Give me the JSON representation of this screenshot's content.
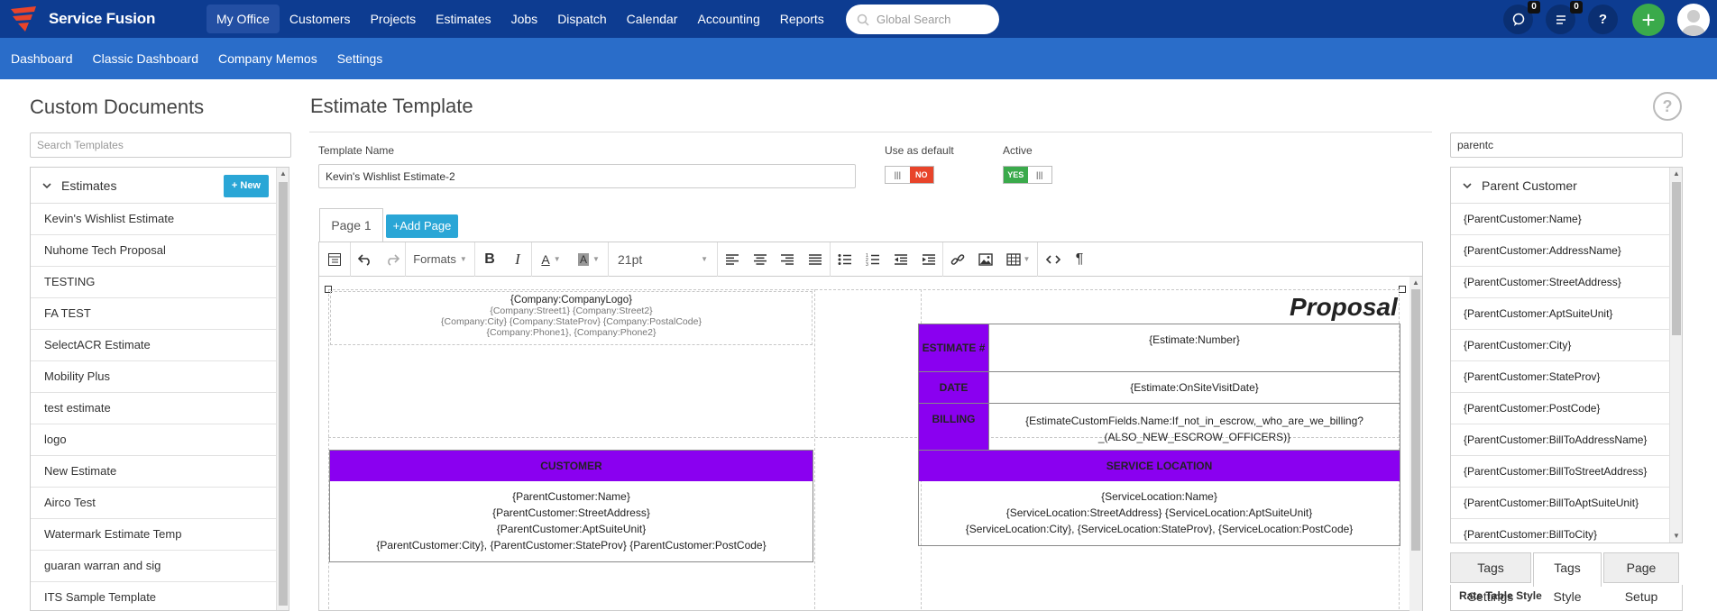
{
  "brand": {
    "name": "Service Fusion"
  },
  "topnav": {
    "items": [
      "My Office",
      "Customers",
      "Projects",
      "Estimates",
      "Jobs",
      "Dispatch",
      "Calendar",
      "Accounting",
      "Reports"
    ],
    "active": "My Office",
    "search_placeholder": "Global Search",
    "chat_count": "0",
    "tasks_count": "0",
    "help_label": "?"
  },
  "subnav": {
    "items": [
      "Dashboard",
      "Classic Dashboard",
      "Company Memos",
      "Settings"
    ]
  },
  "left": {
    "title": "Custom Documents",
    "search_placeholder": "Search Templates",
    "section": "Estimates",
    "new_label": "New",
    "items": [
      "Kevin's Wishlist Estimate",
      "Nuhome Tech Proposal",
      "TESTING",
      "FA TEST",
      "SelectACR Estimate",
      "Mobility Plus",
      "test estimate",
      "logo",
      "New Estimate",
      "Airco Test",
      "Watermark Estimate Temp",
      "guaran warran and sig",
      "ITS Sample Template"
    ]
  },
  "main": {
    "title": "Estimate Template",
    "help": "?",
    "template_name_label": "Template Name",
    "template_name_value": "Kevin's Wishlist Estimate-2",
    "default_label": "Use as default",
    "default_state": "NO",
    "active_label": "Active",
    "active_state": "YES",
    "page_tab": "Page 1",
    "add_page": "Add Page",
    "toolbar": {
      "formats": "Formats",
      "font_size": "21pt"
    }
  },
  "doc": {
    "company": {
      "logo": "{Company:CompanyLogo}",
      "street": "{Company:Street1} {Company:Street2}",
      "city": "{Company:City} {Company:StateProv} {Company:PostalCode}",
      "phone": "{Company:Phone1}, {Company:Phone2}"
    },
    "proposal": "Proposal",
    "estimate_label": "ESTIMATE #",
    "estimate_value": "{Estimate:Number}",
    "date_label": "DATE",
    "date_value": "{Estimate:OnSiteVisitDate}",
    "billing_label": "BILLING",
    "billing_value_1": "{EstimateCustomFields.Name:If_not_in_escrow,_who_are_we_billing?",
    "billing_value_2": "_(ALSO_NEW_ESCROW_OFFICERS)}",
    "customer_header": "CUSTOMER",
    "customer_lines": [
      "{ParentCustomer:Name}",
      "{ParentCustomer:StreetAddress}",
      "{ParentCustomer:AptSuiteUnit}",
      "{ParentCustomer:City}, {ParentCustomer:StateProv} {ParentCustomer:PostCode}"
    ],
    "service_header": "SERVICE LOCATION",
    "service_lines": [
      "{ServiceLocation:Name}",
      "{ServiceLocation:StreetAddress} {ServiceLocation:AptSuiteUnit}",
      "{ServiceLocation:City}, {ServiceLocation:StateProv}, {ServiceLocation:PostCode}"
    ]
  },
  "right": {
    "search_value": "parentc",
    "section": "Parent Customer",
    "tags": [
      "{ParentCustomer:Name}",
      "{ParentCustomer:AddressName}",
      "{ParentCustomer:StreetAddress}",
      "{ParentCustomer:AptSuiteUnit}",
      "{ParentCustomer:City}",
      "{ParentCustomer:StateProv}",
      "{ParentCustomer:PostCode}",
      "{ParentCustomer:BillToAddressName}",
      "{ParentCustomer:BillToStreetAddress}",
      "{ParentCustomer:BillToAptSuiteUnit}",
      "{ParentCustomer:BillToCity}"
    ],
    "tabs": [
      "Tags Settings",
      "Tags Style",
      "Page Setup"
    ],
    "active_tab": "Tags Style",
    "style_section": "Rate Table Style"
  },
  "colors": {
    "nav": "#0d3c91",
    "subnav": "#2a6dc9",
    "accent": "#2aa6d6",
    "purple": "#8a00f0",
    "green": "#3aaa4b",
    "red": "#e8442a"
  }
}
